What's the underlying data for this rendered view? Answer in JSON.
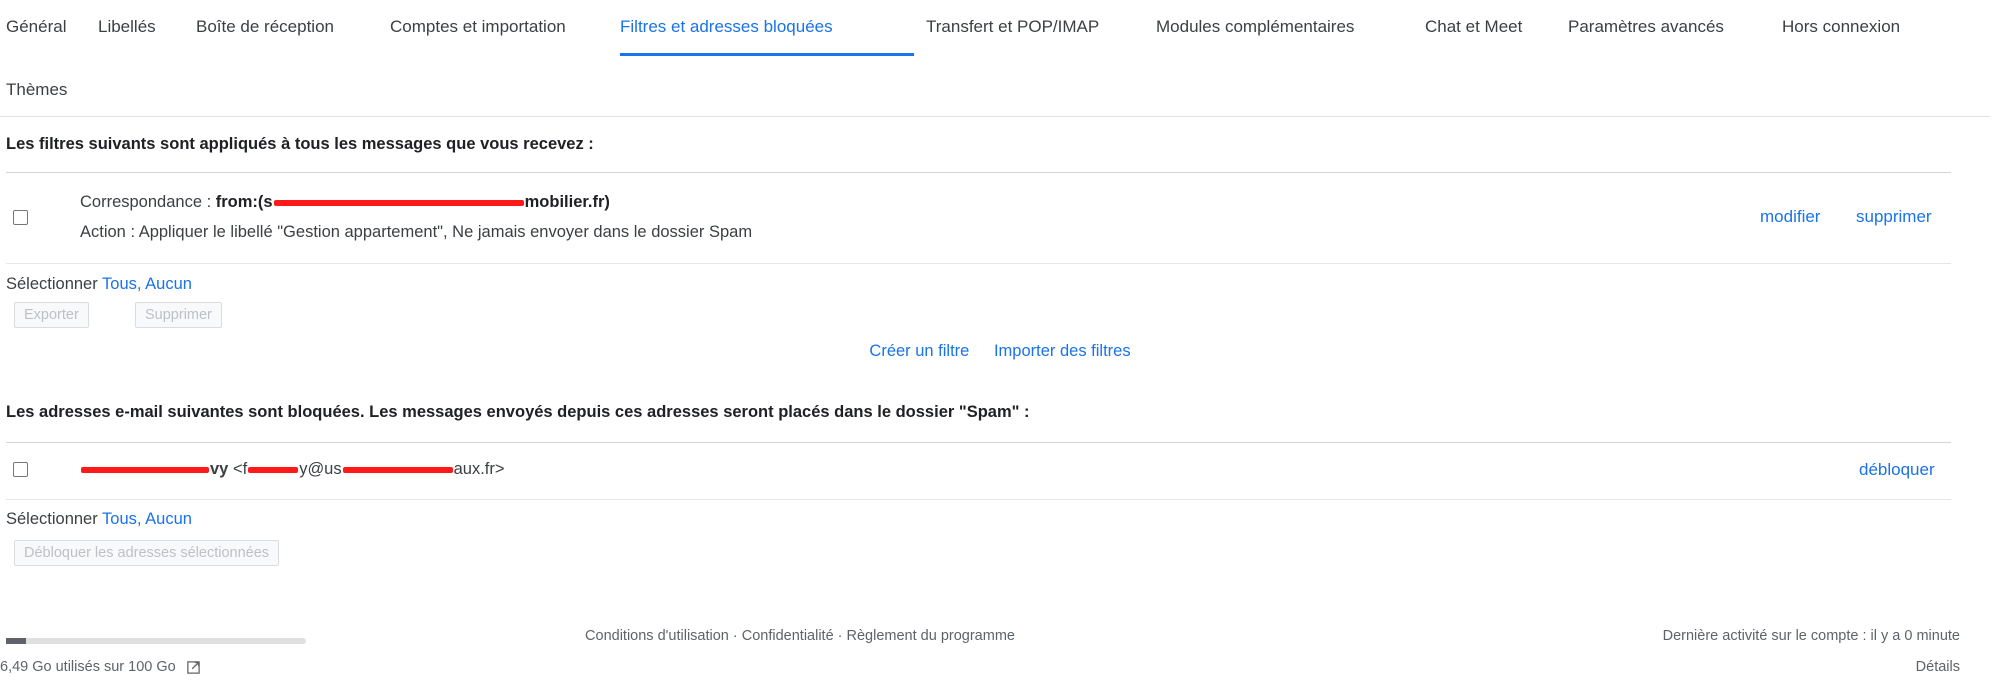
{
  "tabs": [
    {
      "label": "Général",
      "active": false
    },
    {
      "label": "Libellés",
      "active": false
    },
    {
      "label": "Boîte de réception",
      "active": false
    },
    {
      "label": "Comptes et importation",
      "active": false
    },
    {
      "label": "Filtres et adresses bloquées",
      "active": true
    },
    {
      "label": "Transfert et POP/IMAP",
      "active": false
    },
    {
      "label": "Modules complémentaires",
      "active": false
    },
    {
      "label": "Chat et Meet",
      "active": false
    },
    {
      "label": "Paramètres avancés",
      "active": false
    },
    {
      "label": "Hors connexion",
      "active": false
    }
  ],
  "tab_themes": "Thèmes",
  "filters": {
    "title": "Les filtres suivants sont appliqués à tous les messages que vous recevez :",
    "items": [
      {
        "match_label": "Correspondance :",
        "match_prefix": "from:(s",
        "match_suffix": "mobilier.fr)",
        "action": "Action : Appliquer le libellé \"Gestion appartement\", Ne jamais envoyer dans le dossier Spam",
        "edit_label": "modifier",
        "delete_label": "supprimer"
      }
    ],
    "select_label": "Sélectionner",
    "select_all": "Tous,",
    "select_none": "Aucun",
    "export_button": "Exporter",
    "delete_button": "Supprimer",
    "create_filter": "Créer un filtre",
    "import_filters": "Importer des filtres"
  },
  "blocked": {
    "title": "Les adresses e-mail suivantes sont bloquées. Les messages envoyés depuis ces adresses seront placés dans le dossier \"Spam\" :",
    "items": [
      {
        "name_suffix": "vy",
        "email_prefix": "<f",
        "email_mid": "y@us",
        "email_suffix": "aux.fr>",
        "unblock_label": "débloquer"
      }
    ],
    "select_label": "Sélectionner",
    "select_all": "Tous,",
    "select_none": "Aucun",
    "unblock_button": "Débloquer les adresses sélectionnées"
  },
  "footer": {
    "storage_text": "6,49 Go utilisés sur 100 Go",
    "storage_fraction": 0.065,
    "links": "Conditions d'utilisation · Confidentialité · Règlement du programme",
    "last_activity": "Dernière activité sur le compte : il y a 0 minute",
    "details": "Détails"
  },
  "colors": {
    "accent": "#1a73e8",
    "redaction": "#ff1a1a"
  }
}
